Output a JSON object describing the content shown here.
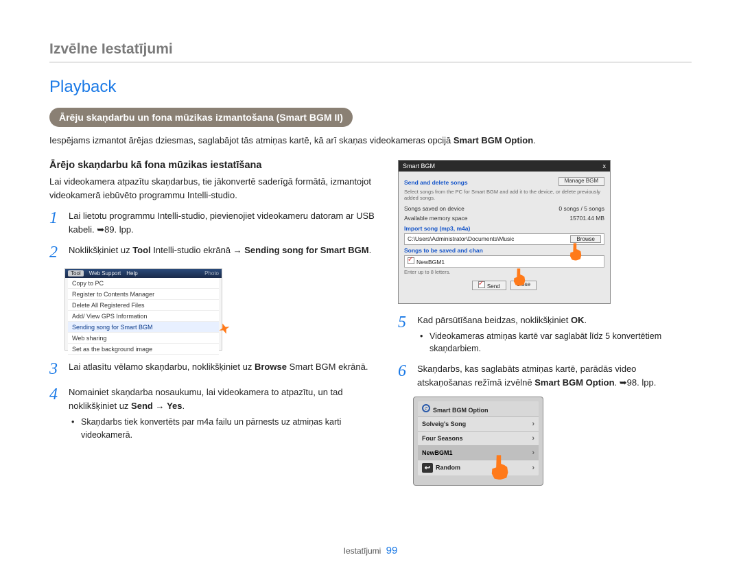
{
  "breadcrumb": "Izvēlne Iestatījumi",
  "section_title": "Playback",
  "pill": "Ārēju skaņdarbu un fona mūzikas izmantošana (Smart BGM II)",
  "intro_pre": "Iespējams izmantot ārējas dziesmas, saglabājot tās atmiņas kartē, kā arī skaņas videokameras opcijā ",
  "intro_bold": "Smart BGM Option",
  "intro_post": ".",
  "subhead": "Ārējo skaņdarbu kā fona mūzikas iestatīšana",
  "intro2": "Lai videokamera atpazītu skaņdarbus, tie jākonvertē saderīgā formātā, izmantojot videokamerā iebūvēto programmu Intelli-studio.",
  "steps": {
    "1": "Lai lietotu programmu Intelli-studio, pievienojiet videokameru datoram ar USB kabeli. ➥89. lpp.",
    "2_pre": "Noklikšķiniet uz ",
    "2_b1": "Tool",
    "2_mid": " Intelli-studio ekrānā → ",
    "2_b2": "Sending song for Smart BGM",
    "2_post": ".",
    "3_pre": "Lai atlasītu vēlamo skaņdarbu, noklikšķiniet uz ",
    "3_b": "Browse",
    "3_post": " Smart BGM ekrānā.",
    "4_pre": "Nomainiet skaņdarba nosaukumu, lai videokamera to atpazītu, un tad noklikšķiniet uz ",
    "4_b1": "Send",
    "4_mid": " → ",
    "4_b2": "Yes",
    "4_post": ".",
    "4_bullet": "Skaņdarbs tiek konvertēts par m4a failu un pārnests uz atmiņas karti videokamerā.",
    "5_pre": "Kad pārsūtīšana beidzas, noklikšķiniet ",
    "5_b": "OK",
    "5_post": ".",
    "5_bullet": "Videokameras atmiņas kartē var saglabāt līdz 5 konvertētiem skaņdarbiem.",
    "6_pre": "Skaņdarbs, kas saglabāts atmiņas kartē, parādās video atskaņošanas režīmā izvēlnē ",
    "6_b": "Smart BGM Option",
    "6_post": ". ➥98. lpp."
  },
  "fig1": {
    "tabs": {
      "tool": "Tool",
      "web": "Web Support",
      "help": "Help"
    },
    "items": [
      "Copy to PC",
      "Register to Contents Manager",
      "Delete All Registered Files",
      "Add/ View GPS Information",
      "Sending song for Smart BGM",
      "Web sharing",
      "Set as the background image"
    ],
    "side": "Photo"
  },
  "fig2": {
    "title": "Smart BGM",
    "close": "x",
    "h1": "Send and delete songs",
    "manage": "Manage BGM",
    "desc": "Select songs from the PC for Smart BGM and add it to the device, or delete previously added songs.",
    "r1a": "Songs saved on device",
    "r1b": "0 songs / 5 songs",
    "r2a": "Available memory space",
    "r2b": "15701.44 MB",
    "h2": "Import song (mp3, m4a)",
    "path": "C:\\Users\\Administrator\\Documents\\Music",
    "browse": "Browse",
    "h3": "Songs to be saved and chan",
    "name": "NewBGM1",
    "limit": "Enter up to 8 letters.",
    "send": "Send",
    "close_btn": "Close"
  },
  "fig3": {
    "title": "Smart BGM Option",
    "items": [
      "Solveig's Song",
      "Four Seasons",
      "NewBGM1",
      "Random"
    ]
  },
  "footer_label": "Iestatījumi",
  "page_number": "99"
}
